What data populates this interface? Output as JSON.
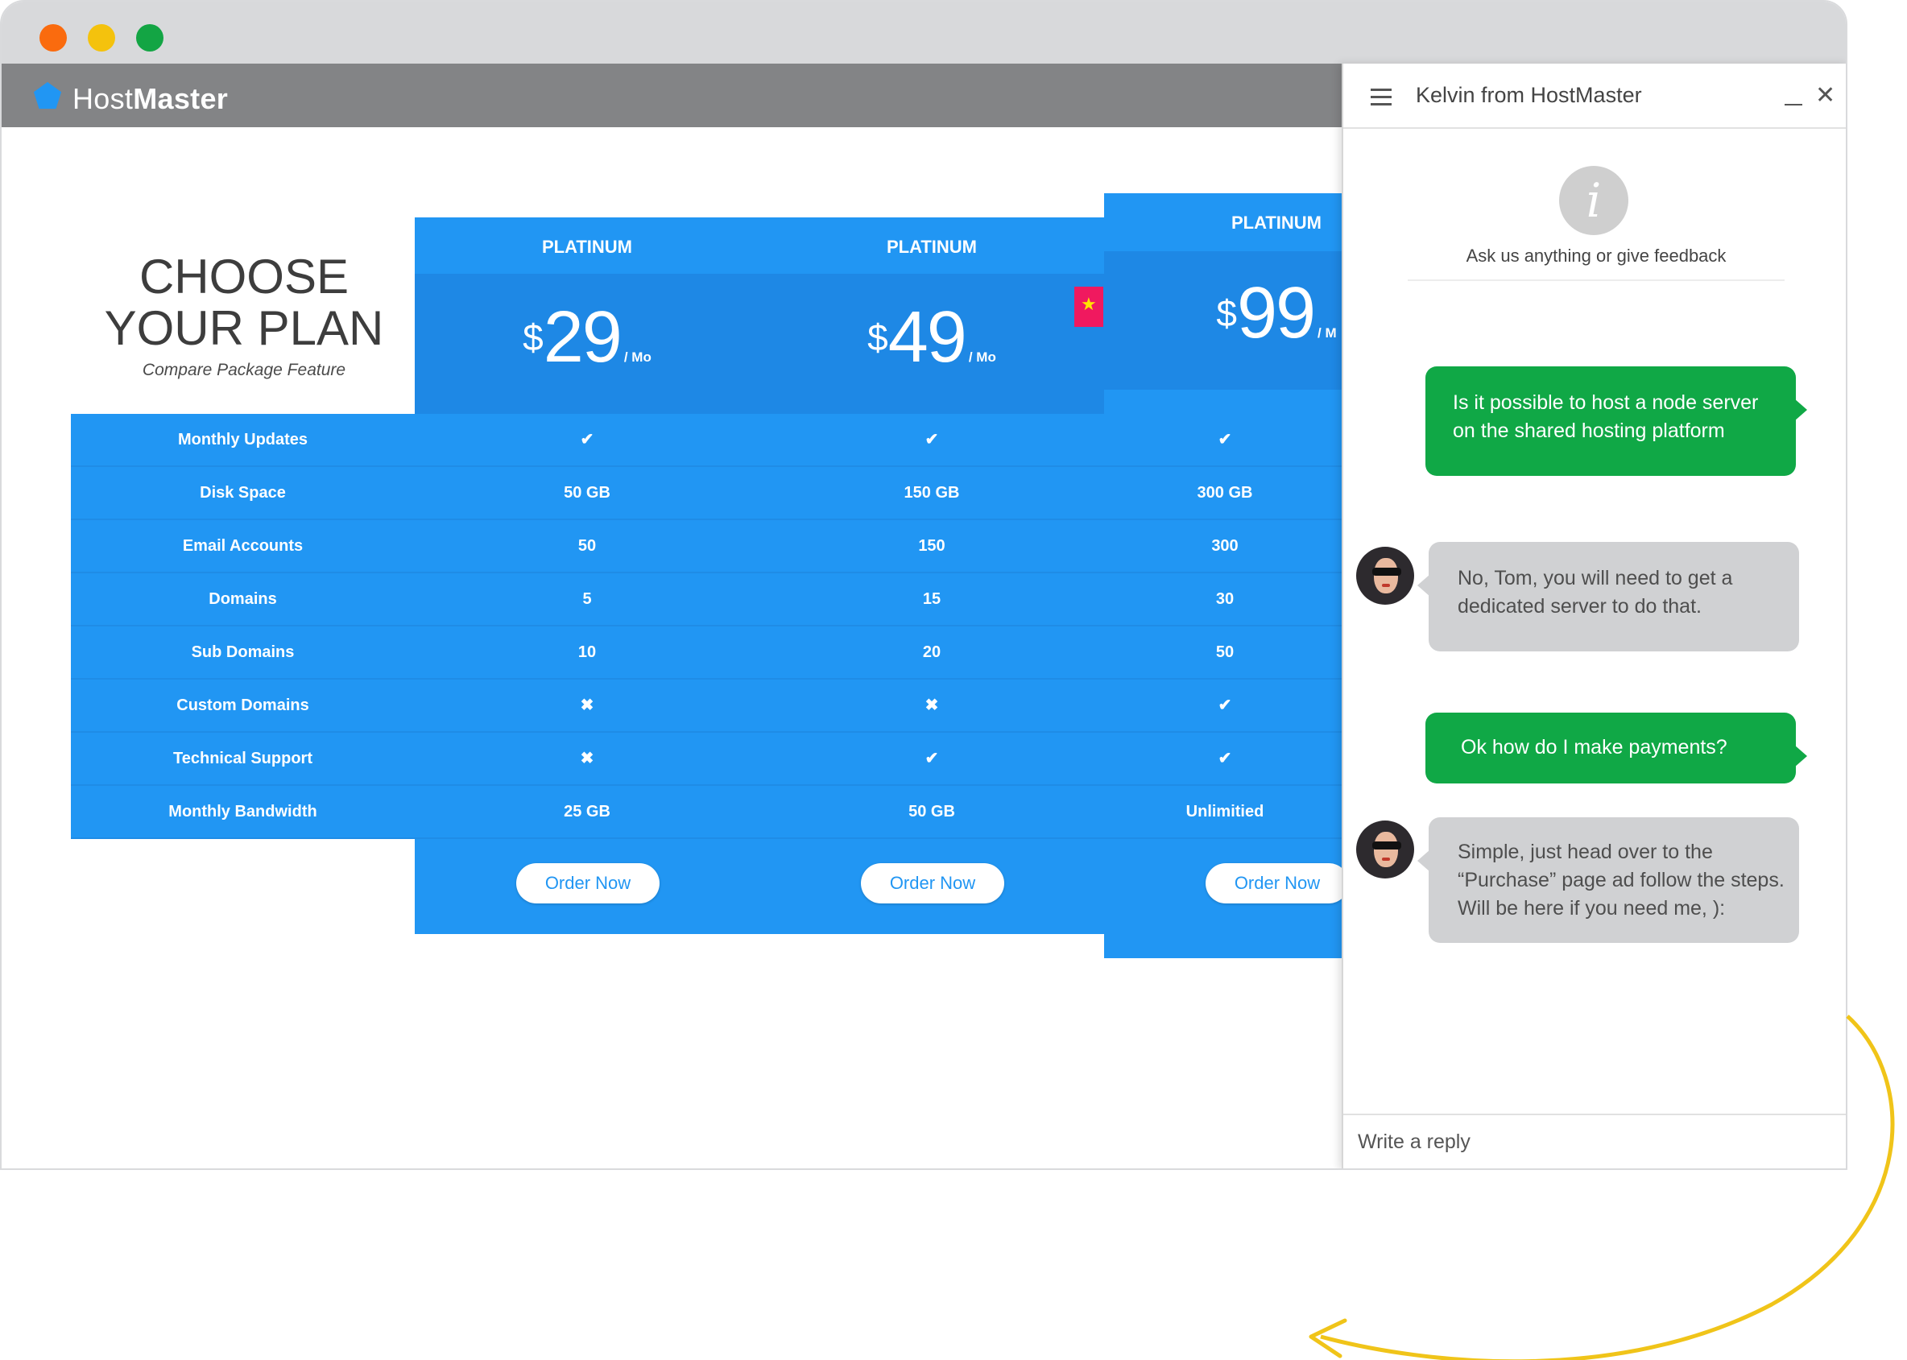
{
  "app": {
    "brand_light": "Host",
    "brand_bold": "Master"
  },
  "pricing": {
    "title_line1": "CHOOSE",
    "title_line2": "YOUR PLAN",
    "subtitle": "Compare Package Feature",
    "features": [
      "Monthly Updates",
      "Disk Space",
      "Email Accounts",
      "Domains",
      "Sub Domains",
      "Custom Domains",
      "Technical Support",
      "Monthly Bandwidth"
    ],
    "plans": [
      {
        "name": "PLATINUM",
        "currency": "$",
        "price": "29",
        "per": "/ Mo",
        "values": [
          "✔",
          "50 GB",
          "50",
          "5",
          "10",
          "✖",
          "✖",
          "25 GB"
        ],
        "order_label": "Order Now"
      },
      {
        "name": "PLATINUM",
        "currency": "$",
        "price": "49",
        "per": "/ Mo",
        "values": [
          "✔",
          "150 GB",
          "150",
          "15",
          "20",
          "✖",
          "✔",
          "50 GB"
        ],
        "order_label": "Order Now"
      },
      {
        "name": "PLATINUM",
        "currency": "$",
        "price": "99",
        "per": "/ M",
        "values": [
          "✔",
          "300 GB",
          "300",
          "30",
          "50",
          "✔",
          "✔",
          "Unlimitied"
        ],
        "order_label": "Order Now"
      }
    ],
    "colors": {
      "primary": "#2196f3",
      "price_band": "#1e88e5",
      "ribbon": "#f0195f"
    }
  },
  "chat": {
    "title": "Kelvin from HostMaster",
    "intro": "Ask us anything or give feedback",
    "messages": [
      {
        "from": "user",
        "lines": [
          "Is it possible to host a node server",
          "on the shared hosting platform"
        ]
      },
      {
        "from": "agent",
        "lines": [
          "No, Tom, you will need to get a",
          "dedicated server to do that."
        ]
      },
      {
        "from": "user",
        "lines": [
          "Ok how do I make payments?"
        ]
      },
      {
        "from": "agent",
        "lines": [
          "Simple, just head over to the",
          "“Purchase” page ad follow the steps.",
          "Will be here if you need me, ):"
        ]
      }
    ],
    "reply_placeholder": "Write a reply",
    "colors": {
      "user_bubble": "#10a846",
      "agent_bubble": "#d0d1d3"
    }
  }
}
